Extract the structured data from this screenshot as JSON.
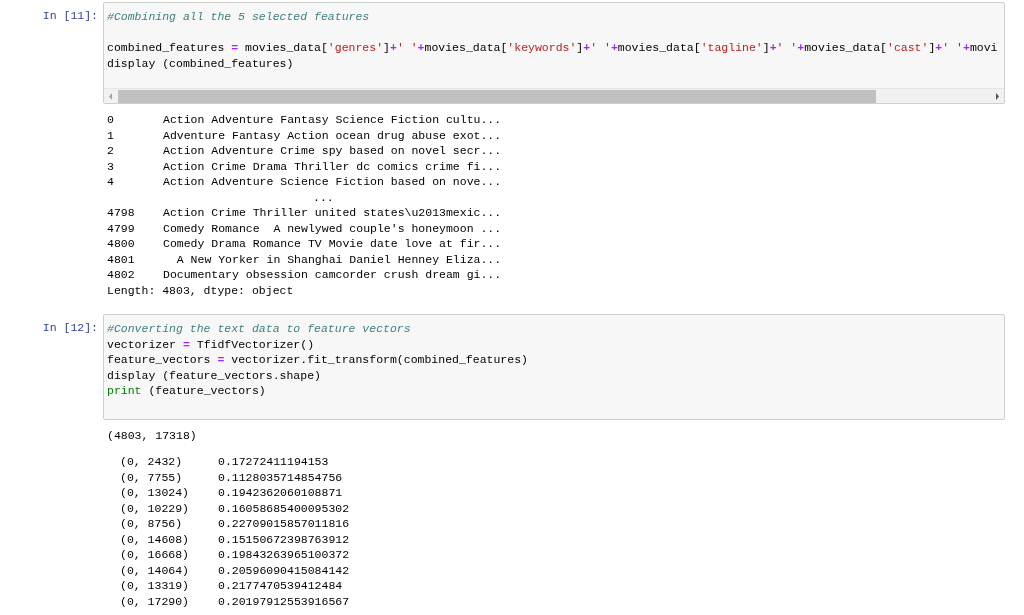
{
  "cells": [
    {
      "prompt": "In [11]:",
      "h_scrollbar": true,
      "code": [
        {
          "kind": "code",
          "tokens": [
            {
              "kind": "comment",
              "text": "#Combining all the 5 selected features"
            }
          ]
        },
        {
          "kind": "blank"
        },
        {
          "kind": "code",
          "tokens": [
            {
              "kind": "plain",
              "text": "combined_features "
            },
            {
              "kind": "op",
              "text": "="
            },
            {
              "kind": "plain",
              "text": " movies_data["
            },
            {
              "kind": "string",
              "text": "'genres'"
            },
            {
              "kind": "plain",
              "text": "]"
            },
            {
              "kind": "op",
              "text": "+"
            },
            {
              "kind": "string",
              "text": "' '"
            },
            {
              "kind": "op",
              "text": "+"
            },
            {
              "kind": "plain",
              "text": "movies_data["
            },
            {
              "kind": "string",
              "text": "'keywords'"
            },
            {
              "kind": "plain",
              "text": "]"
            },
            {
              "kind": "op",
              "text": "+"
            },
            {
              "kind": "string",
              "text": "' '"
            },
            {
              "kind": "op",
              "text": "+"
            },
            {
              "kind": "plain",
              "text": "movies_data["
            },
            {
              "kind": "string",
              "text": "'tagline'"
            },
            {
              "kind": "plain",
              "text": "]"
            },
            {
              "kind": "op",
              "text": "+"
            },
            {
              "kind": "string",
              "text": "' '"
            },
            {
              "kind": "op",
              "text": "+"
            },
            {
              "kind": "plain",
              "text": "movies_data["
            },
            {
              "kind": "string",
              "text": "'cast'"
            },
            {
              "kind": "plain",
              "text": "]"
            },
            {
              "kind": "op",
              "text": "+"
            },
            {
              "kind": "string",
              "text": "' '"
            },
            {
              "kind": "op",
              "text": "+"
            },
            {
              "kind": "plain",
              "text": "movi"
            }
          ]
        },
        {
          "kind": "code",
          "tokens": [
            {
              "kind": "plain",
              "text": "display (combined_features)"
            }
          ]
        }
      ],
      "outputs": [
        {
          "kind": "series",
          "rows": [
            {
              "kind": "row",
              "index": "0",
              "value": "Action Adventure Fantasy Science Fiction cultu..."
            },
            {
              "kind": "row",
              "index": "1",
              "value": "Adventure Fantasy Action ocean drug abuse exot..."
            },
            {
              "kind": "row",
              "index": "2",
              "value": "Action Adventure Crime spy based on novel secr..."
            },
            {
              "kind": "row",
              "index": "3",
              "value": "Action Crime Drama Thriller dc comics crime fi..."
            },
            {
              "kind": "row",
              "index": "4",
              "value": "Action Adventure Science Fiction based on nove..."
            },
            {
              "kind": "ellipsis",
              "value": "..."
            },
            {
              "kind": "row",
              "index": "4798",
              "value": "Action Crime Thriller united states\\u2013mexic..."
            },
            {
              "kind": "row",
              "index": "4799",
              "value": "Comedy Romance  A newlywed couple's honeymoon ..."
            },
            {
              "kind": "row",
              "index": "4800",
              "value": "Comedy Drama Romance TV Movie date love at fir..."
            },
            {
              "kind": "row",
              "index": "4801",
              "value": "  A New Yorker in Shanghai Daniel Henney Eliza..."
            },
            {
              "kind": "row",
              "index": "4802",
              "value": "Documentary obsession camcorder crush dream gi..."
            }
          ],
          "footer": "Length: 4803, dtype: object"
        }
      ]
    },
    {
      "prompt": "In [12]:",
      "h_scrollbar": false,
      "code": [
        {
          "kind": "code",
          "tokens": [
            {
              "kind": "comment",
              "text": "#Converting the text data to feature vectors"
            }
          ]
        },
        {
          "kind": "code",
          "tokens": [
            {
              "kind": "plain",
              "text": "vectorizer "
            },
            {
              "kind": "op",
              "text": "="
            },
            {
              "kind": "plain",
              "text": " TfidfVectorizer()"
            }
          ]
        },
        {
          "kind": "code",
          "tokens": [
            {
              "kind": "plain",
              "text": "feature_vectors "
            },
            {
              "kind": "op",
              "text": "="
            },
            {
              "kind": "plain",
              "text": " vectorizer.fit_transform(combined_features)"
            }
          ]
        },
        {
          "kind": "code",
          "tokens": [
            {
              "kind": "plain",
              "text": "display (feature_vectors.shape)"
            }
          ]
        },
        {
          "kind": "code",
          "tokens": [
            {
              "kind": "builtin",
              "text": "print"
            },
            {
              "kind": "plain",
              "text": " (feature_vectors)"
            }
          ]
        }
      ],
      "outputs": [
        {
          "kind": "text",
          "text": "(4803, 17318)"
        },
        {
          "kind": "sparse",
          "rows": [
            {
              "key": "(0, 2432)",
              "value": "0.17272411194153"
            },
            {
              "key": "(0, 7755)",
              "value": "0.1128035714854756"
            },
            {
              "key": "(0, 13024)",
              "value": "0.1942362060108871"
            },
            {
              "key": "(0, 10229)",
              "value": "0.16058685400095302"
            },
            {
              "key": "(0, 8756)",
              "value": "0.22709015857011816"
            },
            {
              "key": "(0, 14608)",
              "value": "0.15150672398763912"
            },
            {
              "key": "(0, 16668)",
              "value": "0.19843263965100372"
            },
            {
              "key": "(0, 14064)",
              "value": "0.20596090415084142"
            },
            {
              "key": "(0, 13319)",
              "value": "0.2177470539412484"
            },
            {
              "key": "(0, 17290)",
              "value": "0.20197912553916567"
            }
          ]
        }
      ]
    }
  ]
}
